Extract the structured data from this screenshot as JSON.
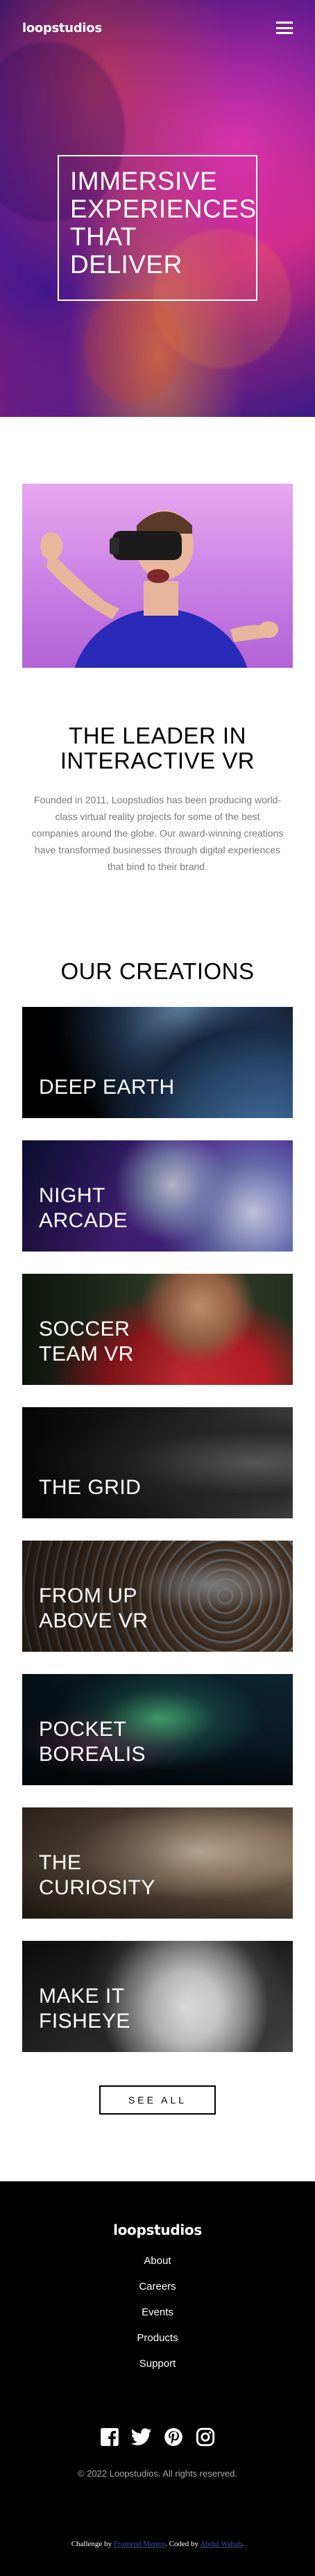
{
  "header": {
    "logo": "loopstudios",
    "hero_title": "IMMERSIVE EXPERIENCES THAT DELIVER"
  },
  "about": {
    "heading": "THE LEADER IN INTERACTIVE VR",
    "body": "Founded in 2011, Loopstudios has been producing world-class virtual reality projects for some of the best companies around the globe. Our award-winning creations have transformed businesses through digital experiences that bind to their brand."
  },
  "creations": {
    "heading": "OUR CREATIONS",
    "items": [
      {
        "title": "DEEP EARTH"
      },
      {
        "title": "NIGHT ARCADE"
      },
      {
        "title": "SOCCER TEAM VR"
      },
      {
        "title": "THE GRID"
      },
      {
        "title": "FROM UP ABOVE VR"
      },
      {
        "title": "POCKET BOREALIS"
      },
      {
        "title": "THE CURIOSITY"
      },
      {
        "title": "MAKE IT FISHEYE"
      }
    ],
    "see_all": "SEE ALL"
  },
  "footer": {
    "logo": "loopstudios",
    "nav": [
      "About",
      "Careers",
      "Events",
      "Products",
      "Support"
    ],
    "socials": [
      "facebook-icon",
      "twitter-icon",
      "pinterest-icon",
      "instagram-icon"
    ],
    "copyright": "© 2022 Loopstudios. All rights reserved.",
    "attribution": {
      "prefix": "Challenge by",
      "link1": "Frontend Mentor",
      "middle": ". Coded by",
      "link2": "Abdul Wahab",
      "suffix": "."
    }
  },
  "colors": {
    "footer_bg": "#000000",
    "body_text": "#7a7a7a",
    "link": "#3e52a3"
  }
}
